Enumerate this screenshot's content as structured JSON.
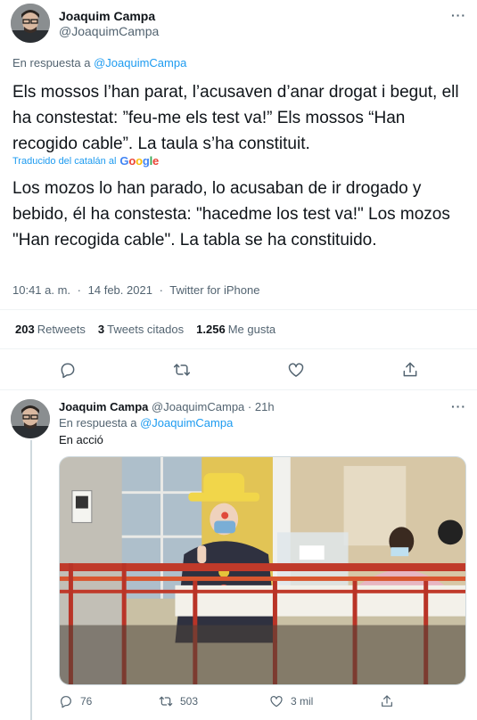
{
  "tweet": {
    "author_name": "Joaquim Campa",
    "author_handle": "@JoaquimCampa",
    "more_label": "···",
    "reply_prefix": "En respuesta a",
    "reply_to": "@JoaquimCampa",
    "text": "Els mossos l’han parat, l’acusaven d’anar drogat i begut, ell ha constestat: ”feu-me els test va!” Els mossos “Han recogido cable”. La taula s’ha constituit.",
    "translated_label": "Traducido del catalán al",
    "translation_brand": "Google",
    "translation_text": "Los mozos lo han parado, lo acusaban de ir drogado y bebido, él ha constesta: \"hacedme los test va!\" Los mozos \"Han recogida cable\". La tabla se ha constituido.",
    "time": "10:41 a. m.",
    "date": "14 feb. 2021",
    "separator": "·",
    "source": "Twitter for iPhone",
    "stats": {
      "retweets_count": "203",
      "retweets_label": "Retweets",
      "quotes_count": "3",
      "quotes_label": "Tweets citados",
      "likes_count": "1.256",
      "likes_label": "Me gusta"
    },
    "actions": [
      "reply-icon",
      "retweet-icon",
      "like-icon",
      "share-icon"
    ]
  },
  "reply": {
    "author_name": "Joaquim Campa",
    "author_handle": "@JoaquimCampa",
    "separator": "·",
    "time_ago": "21h",
    "more_label": "···",
    "reply_prefix": "En respuesta a",
    "reply_to": "@JoaquimCampa",
    "text": "En acció",
    "actions": {
      "reply_count": "76",
      "retweet_count": "503",
      "like_count": "3 mil"
    }
  },
  "colors": {
    "accent": "#1d9bf0",
    "text_primary": "#0f1419",
    "text_secondary": "#536471",
    "divider": "#eff3f4"
  }
}
